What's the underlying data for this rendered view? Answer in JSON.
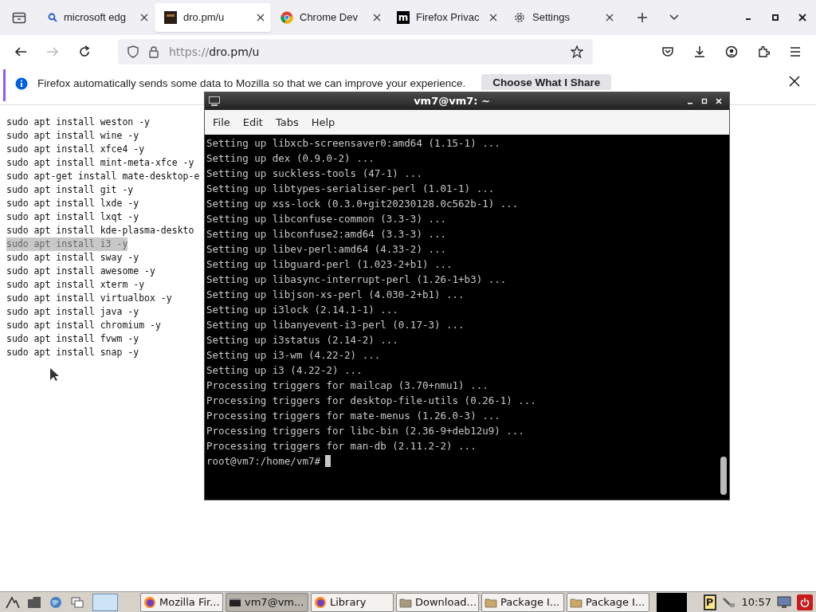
{
  "tabs": [
    {
      "label": "microsoft edg",
      "kind": "search",
      "selected": false
    },
    {
      "label": "dro.pm/u",
      "kind": "favicon",
      "selected": true
    },
    {
      "label": "Chrome Dev",
      "kind": "chrome",
      "selected": false
    },
    {
      "label": "Firefox Privac",
      "kind": "m",
      "selected": false
    },
    {
      "label": "Settings",
      "kind": "gear",
      "selected": false
    }
  ],
  "tab_icon_text": "m",
  "address": {
    "scheme": "https://",
    "host": "dro.pm/u"
  },
  "notification": {
    "text": "Firefox automatically sends some data to Mozilla so that we can improve your experience.",
    "button": "Choose What I Share"
  },
  "page_lines": [
    {
      "text": "sudo apt install weston -y",
      "selected": false
    },
    {
      "text": "sudo apt install wine -y",
      "selected": false
    },
    {
      "text": "sudo apt install xfce4 -y",
      "selected": false
    },
    {
      "text": "sudo apt install mint-meta-xfce -y",
      "selected": false
    },
    {
      "text": "sudo apt-get install mate-desktop-e",
      "selected": false
    },
    {
      "text": "sudo apt install git -y",
      "selected": false
    },
    {
      "text": "sudo apt install lxde -y",
      "selected": false
    },
    {
      "text": "sudo apt install lxqt -y",
      "selected": false
    },
    {
      "text": "sudo apt install kde-plasma-deskto",
      "selected": false
    },
    {
      "text": "sudo apt install i3 -y",
      "selected": true
    },
    {
      "text": "sudo apt install sway -y",
      "selected": false
    },
    {
      "text": "sudo apt install awesome -y",
      "selected": false
    },
    {
      "text": "sudo apt install xterm -y",
      "selected": false
    },
    {
      "text": "sudo apt install virtualbox -y",
      "selected": false
    },
    {
      "text": "sudo apt install java -y",
      "selected": false
    },
    {
      "text": "sudo apt install chromium -y",
      "selected": false
    },
    {
      "text": "sudo apt install fvwm -y",
      "selected": false
    },
    {
      "text": "sudo apt install snap -y",
      "selected": false
    }
  ],
  "terminal": {
    "title": "vm7@vm7: ~",
    "menu": [
      "File",
      "Edit",
      "Tabs",
      "Help"
    ],
    "lines": [
      "Setting up libxcb-screensaver0:amd64 (1.15-1) ...",
      "Setting up dex (0.9.0-2) ...",
      "Setting up suckless-tools (47-1) ...",
      "Setting up libtypes-serialiser-perl (1.01-1) ...",
      "Setting up xss-lock (0.3.0+git20230128.0c562b-1) ...",
      "Setting up libconfuse-common (3.3-3) ...",
      "Setting up libconfuse2:amd64 (3.3-3) ...",
      "Setting up libev-perl:amd64 (4.33-2) ...",
      "Setting up libguard-perl (1.023-2+b1) ...",
      "Setting up libasync-interrupt-perl (1.26-1+b3) ...",
      "Setting up libjson-xs-perl (4.030-2+b1) ...",
      "Setting up i3lock (2.14.1-1) ...",
      "Setting up libanyevent-i3-perl (0.17-3) ...",
      "Setting up i3status (2.14-2) ...",
      "Setting up i3-wm (4.22-2) ...",
      "Setting up i3 (4.22-2) ...",
      "Processing triggers for mailcap (3.70+nmu1) ...",
      "Processing triggers for desktop-file-utils (0.26-1) ...",
      "Processing triggers for mate-menus (1.26.0-3) ...",
      "Processing triggers for libc-bin (2.36-9+deb12u9) ...",
      "Processing triggers for man-db (2.11.2-2) ..."
    ],
    "prompt": "root@vm7:/home/vm7#"
  },
  "taskbar": {
    "windows": [
      {
        "label": "Mozilla Fir...",
        "kind": "firefox",
        "selected": false
      },
      {
        "label": "vm7@vm...",
        "kind": "terminal",
        "selected": true
      },
      {
        "label": "Library",
        "kind": "firefox",
        "selected": false
      },
      {
        "label": "Download...",
        "kind": "folder",
        "selected": false
      },
      {
        "label": "Package I...",
        "kind": "package",
        "selected": false
      },
      {
        "label": "Package I...",
        "kind": "package",
        "selected": false
      }
    ],
    "tray_letter": "P",
    "clock": "10:57"
  }
}
